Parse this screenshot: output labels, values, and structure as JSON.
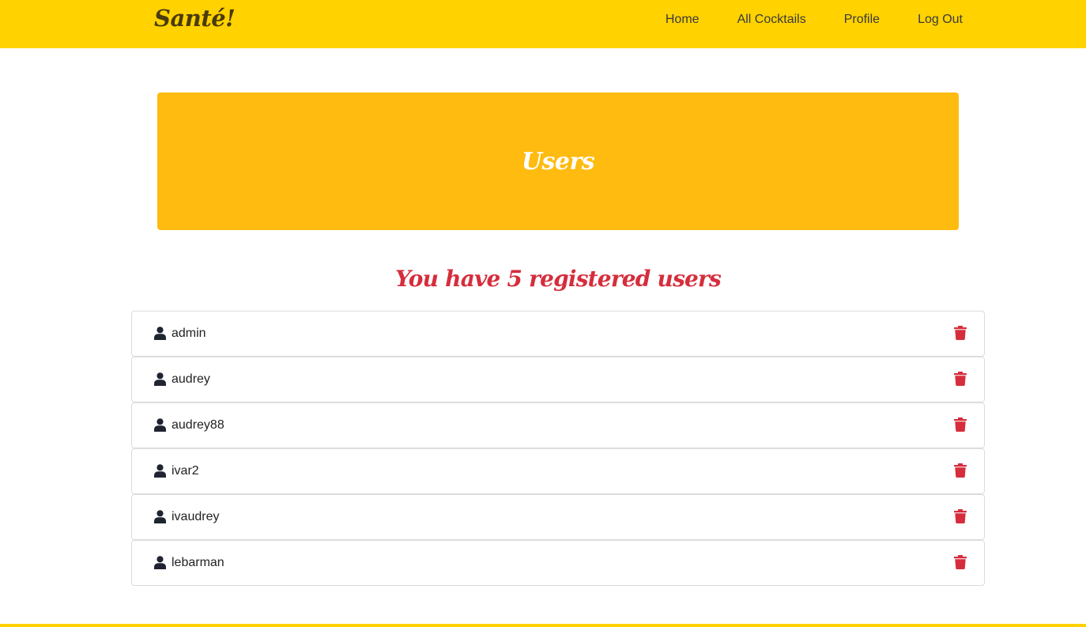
{
  "brand": "Santé!",
  "nav": {
    "items": [
      {
        "label": "Home"
      },
      {
        "label": "All Cocktails"
      },
      {
        "label": "Profile"
      },
      {
        "label": "Log Out"
      }
    ]
  },
  "hero": {
    "title": "Users"
  },
  "users_heading": "You have 5 registered users",
  "users": [
    {
      "name": "admin"
    },
    {
      "name": "audrey"
    },
    {
      "name": "audrey88"
    },
    {
      "name": "ivar2"
    },
    {
      "name": "ivaudrey"
    },
    {
      "name": "lebarman"
    }
  ],
  "icons": {
    "user": "user-icon",
    "delete": "trash-icon"
  },
  "colors": {
    "navbar": "#ffd200",
    "hero": "#ffbb0f",
    "heading": "#d62d3c",
    "trash": "#d62d3c"
  }
}
